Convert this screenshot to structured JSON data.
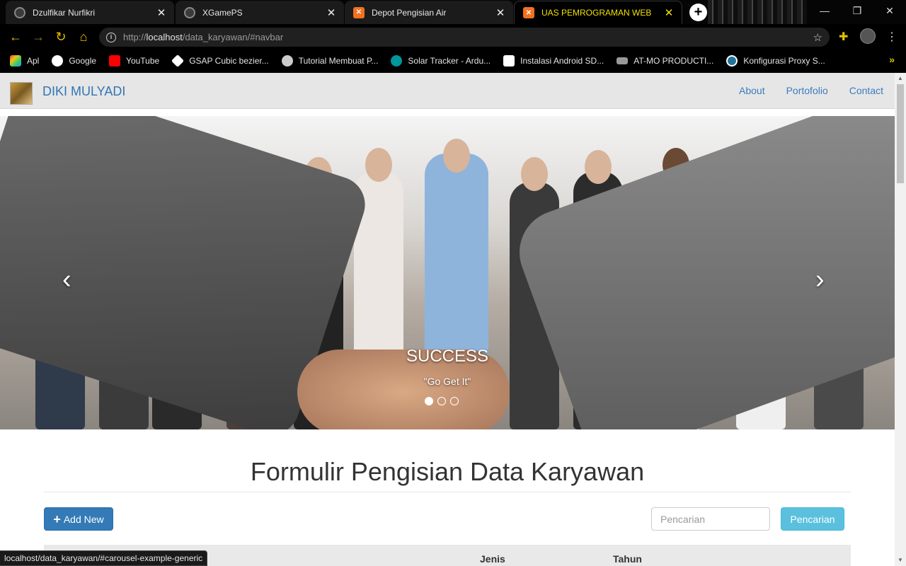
{
  "browser": {
    "tabs": [
      {
        "label": "Dzulfikar Nurfikri",
        "icon": "globe-icon",
        "active": false
      },
      {
        "label": "XGamePS",
        "icon": "globe-icon",
        "active": false
      },
      {
        "label": "Depot Pengisian Air",
        "icon": "xampp-icon",
        "active": false
      },
      {
        "label": "UAS PEMROGRAMAN WEB",
        "icon": "xampp-icon",
        "active": true
      }
    ],
    "new_tab": "+",
    "url_prefix": "http://",
    "url_host": "localhost",
    "url_path": "/data_karyawan/#navbar",
    "bookmarks": [
      {
        "label": "Apl",
        "color": "#e84c3d"
      },
      {
        "label": "Google",
        "color": "#ffffff"
      },
      {
        "label": "YouTube",
        "color": "#ff0000"
      },
      {
        "label": "GSAP Cubic bezier...",
        "color": "#ffffff"
      },
      {
        "label": "Tutorial Membuat P...",
        "color": "#dddddd"
      },
      {
        "label": "Solar Tracker - Ardu...",
        "color": "#00979c"
      },
      {
        "label": "Instalasi Android SD...",
        "color": "#ffffff"
      },
      {
        "label": "AT-MO PRODUCTI...",
        "color": "#bbbbbb"
      },
      {
        "label": "Konfigurasi Proxy S...",
        "color": "#21759b"
      }
    ],
    "status_url": "localhost/data_karyawan/#carousel-example-generic"
  },
  "navbar": {
    "brand": "DIKI MULYADI",
    "links": [
      "About",
      "Portofolio",
      "Contact"
    ]
  },
  "carousel": {
    "title": "SUCCESS",
    "subtitle": "\"Go Get It\"",
    "indicator_count": 3,
    "active_index": 0
  },
  "main": {
    "heading": "Formulir Pengisian Data Karyawan",
    "add_button": "Add New",
    "search_placeholder": "Pencarian",
    "search_button": "Pencarian",
    "table_headers": [
      "Jenis",
      "Tahun"
    ]
  },
  "colors": {
    "primary": "#337ab7",
    "info": "#5bc0de",
    "active_tab_text": "#f0e000"
  }
}
